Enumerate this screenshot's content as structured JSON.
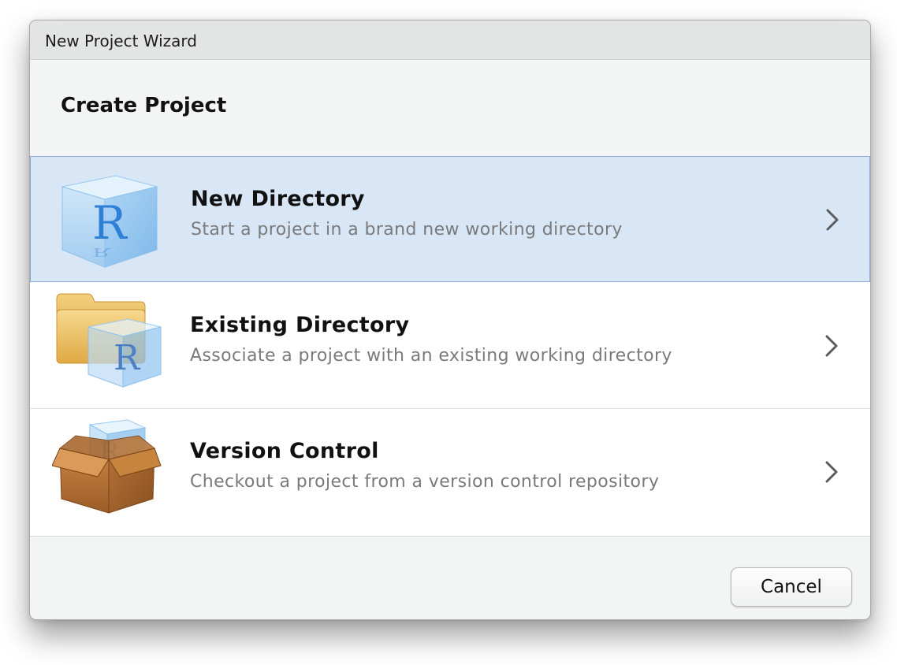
{
  "window": {
    "title": "New Project Wizard"
  },
  "page": {
    "heading": "Create Project"
  },
  "options": [
    {
      "title": "New Directory",
      "description": "Start a project in a brand new working directory",
      "icon": "r-cube-icon",
      "selected": true
    },
    {
      "title": "Existing Directory",
      "description": "Associate a project with an existing working directory",
      "icon": "folder-r-icon",
      "selected": false
    },
    {
      "title": "Version Control",
      "description": "Checkout a project from a version control repository",
      "icon": "box-r-icon",
      "selected": false
    }
  ],
  "footer": {
    "cancel_label": "Cancel"
  },
  "colors": {
    "selected_background": "#d8e6f6",
    "selected_border": "#8ba8d7",
    "r_blue": "#2f7fd6"
  }
}
